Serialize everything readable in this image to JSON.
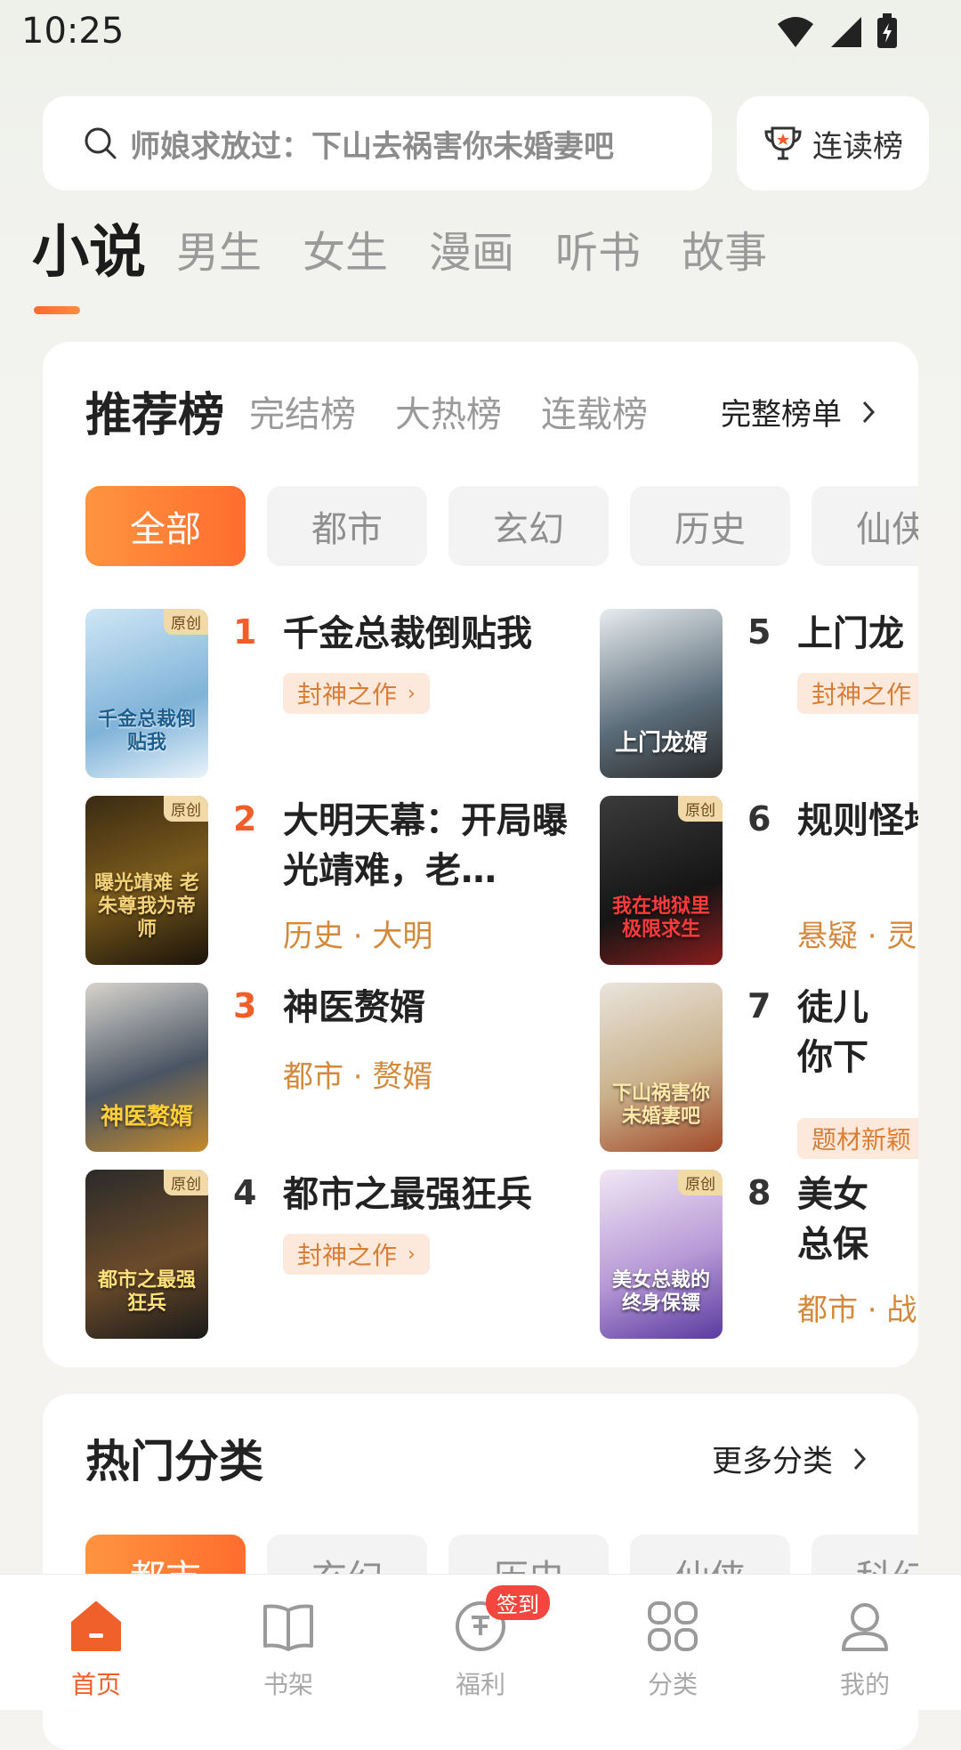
{
  "status": {
    "time": "10:25"
  },
  "search": {
    "placeholder": "师娘求放过：下山去祸害你未婚妻吧"
  },
  "rank_button": {
    "label": "连读榜"
  },
  "top_tabs": [
    "小说",
    "男生",
    "女生",
    "漫画",
    "听书",
    "故事"
  ],
  "rank_section": {
    "tabs": [
      "推荐榜",
      "完结榜",
      "大热榜",
      "连载榜"
    ],
    "full_list": "完整榜单",
    "chips": [
      "全部",
      "都市",
      "玄幻",
      "历史",
      "仙侠"
    ],
    "books": [
      {
        "rank": "1",
        "title": "千金总裁倒贴我",
        "badge": "封神之作",
        "cover_text": "千金总裁倒贴我",
        "tag": "原创"
      },
      {
        "rank": "2",
        "title": "大明天幕：开局曝光靖难，老…",
        "meta": "历史 · 大明",
        "cover_text": "曝光靖难 老朱尊我为帝师",
        "tag": "原创"
      },
      {
        "rank": "3",
        "title": "神医赘婿",
        "meta": "都市 · 赘婿",
        "cover_text": "神医赘婿"
      },
      {
        "rank": "4",
        "title": "都市之最强狂兵",
        "badge": "封神之作",
        "cover_text": "都市之最强狂兵",
        "tag": "原创"
      },
      {
        "rank": "5",
        "title": "上门龙",
        "badge": "封神之作",
        "cover_text": "上门龙婿"
      },
      {
        "rank": "6",
        "title": "规则怪地狱里",
        "meta": "悬疑 · 灵",
        "cover_text": "我在地狱里极限求生",
        "tag": "原创"
      },
      {
        "rank": "7",
        "title": "徒儿你下山祸",
        "badge": "题材新颖",
        "cover_text": "下山祸害你未婚妻吧"
      },
      {
        "rank": "8",
        "title": "美女总保镖",
        "meta": "都市 · 战",
        "cover_text": "美女总裁的终身保镖",
        "tag": "原创"
      }
    ]
  },
  "category_section": {
    "title": "热门分类",
    "more": "更多分类",
    "chips": [
      "都市",
      "玄幻",
      "历史",
      "仙侠",
      "科幻"
    ]
  },
  "nav": [
    {
      "label": "首页",
      "icon": "home-icon"
    },
    {
      "label": "书架",
      "icon": "book-icon"
    },
    {
      "label": "福利",
      "icon": "coin-icon",
      "badge": "签到"
    },
    {
      "label": "分类",
      "icon": "grid-icon"
    },
    {
      "label": "我的",
      "icon": "user-icon"
    }
  ],
  "colors": {
    "accent": "#f0602a",
    "badge_bg": "#fde9dc",
    "meta_text": "#d3893c"
  }
}
